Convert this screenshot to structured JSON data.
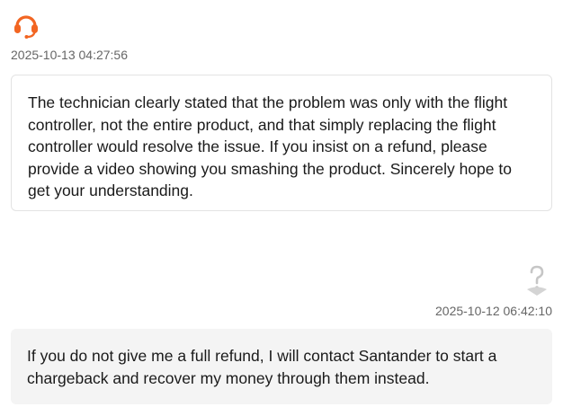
{
  "messages": [
    {
      "sender": "agent",
      "avatar_icon": "headset-icon",
      "timestamp": "2025-10-13 04:27:56",
      "text": "The technician clearly stated that the problem was only with the flight controller, not the entire product, and that simply replacing the flight controller would resolve the issue. If you insist on a refund, please provide a video showing you smashing the product. Sincerely hope to get your understanding."
    },
    {
      "sender": "user",
      "avatar_icon": "unknown-user-icon",
      "timestamp": "2025-10-12 06:42:10",
      "text": "If you do not give me a full refund, I will contact Santander to start a chargeback and recover my money through them instead."
    }
  ],
  "colors": {
    "agent_accent": "#f26522",
    "user_bubble": "#f4f4f4",
    "timestamp_text": "#666666"
  }
}
